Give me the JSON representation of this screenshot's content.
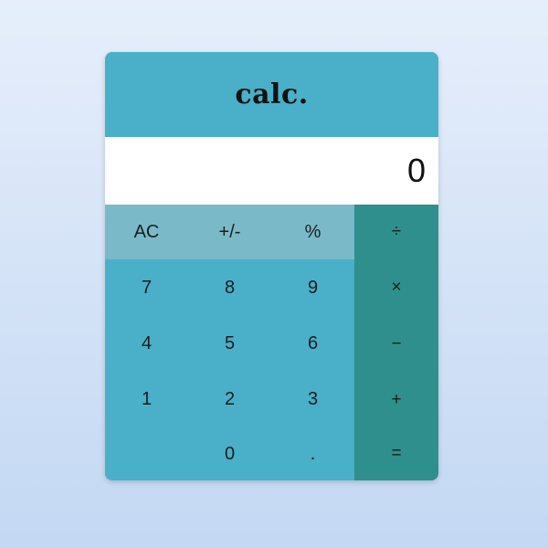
{
  "app": {
    "title": "calc."
  },
  "display": {
    "value": "0"
  },
  "keys": {
    "clear": "AC",
    "sign": "+/-",
    "percent": "%",
    "divide": "÷",
    "seven": "7",
    "eight": "8",
    "nine": "9",
    "multiply": "×",
    "four": "4",
    "five": "5",
    "six": "6",
    "subtract": "−",
    "one": "1",
    "two": "2",
    "three": "3",
    "add": "+",
    "zero": "0",
    "decimal": ".",
    "equals": "="
  },
  "colors": {
    "header_bg": "#4aafc8",
    "number_keys": "#4aafc8",
    "function_keys": "#7ab9c8",
    "operator_keys": "#2e8f8c",
    "display_bg": "#ffffff"
  }
}
